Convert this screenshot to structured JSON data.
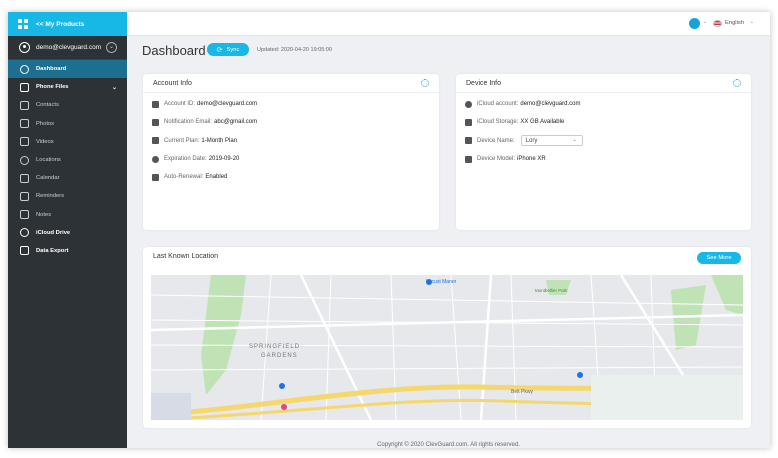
{
  "sidebar": {
    "top_label": "<< My Products",
    "user_email": "demo@clevguard.com",
    "items": [
      {
        "label": "Dashboard"
      },
      {
        "label": "Phone Files"
      },
      {
        "label": "Contacts"
      },
      {
        "label": "Photos"
      },
      {
        "label": "Videos"
      },
      {
        "label": "Locations"
      },
      {
        "label": "Calendar"
      },
      {
        "label": "Reminders"
      },
      {
        "label": "Notes"
      },
      {
        "label": "iCloud Drive"
      },
      {
        "label": "Data Export"
      }
    ]
  },
  "header": {
    "language": "English"
  },
  "page": {
    "title": "Dashboard",
    "sync_label": "Sync",
    "updated": "Updated: 2020-04-20 19:05:00"
  },
  "account": {
    "title": "Account Info",
    "rows": [
      {
        "label": "Account ID:",
        "value": "demo@clevguard.com"
      },
      {
        "label": "Notification Email:",
        "value": "abc@gmail.com"
      },
      {
        "label": "Current Plan:",
        "value": "1-Month Plan"
      },
      {
        "label": "Expiration Date:",
        "value": "2019-09-20"
      },
      {
        "label": "Auto-Renewal:",
        "value": "Enabled"
      }
    ]
  },
  "device": {
    "title": "Device Info",
    "rows": [
      {
        "label": "iCloud account:",
        "value": "demo@clevguard.com"
      },
      {
        "label": "iCloud Storage:",
        "value": "XX GB Available"
      },
      {
        "label": "Device Name:",
        "value": "Lory"
      },
      {
        "label": "Device Model:",
        "value": "iPhone XR"
      }
    ]
  },
  "location": {
    "title": "Last Known Location",
    "see_more": "See More",
    "map_labels": {
      "area": "SPRINGFIELD",
      "area2": "GARDENS",
      "parkway": "Belt Pkwy",
      "mall": "Locust Manor",
      "park": "Montbellier Park"
    }
  },
  "footer": "Copyright © 2020 ClevGuard.com. All rights reserved.",
  "colors": {
    "accent": "#17b7e6",
    "sidebar": "#2d3237",
    "active": "#1c6f8f"
  }
}
